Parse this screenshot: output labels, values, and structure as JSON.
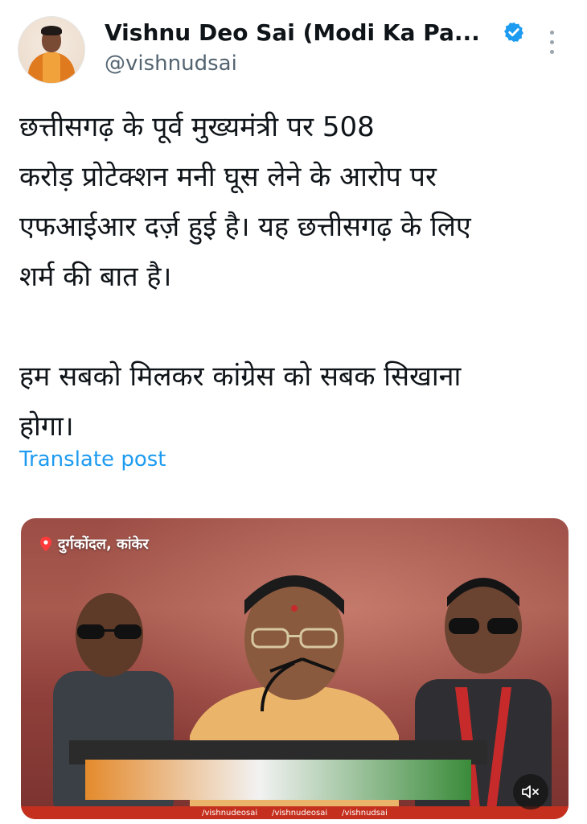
{
  "header": {
    "display_name": "Vishnu Deo Sai (Modi Ka Pa...",
    "handle": "@vishnudsai",
    "verified_icon": "verified-badge-icon",
    "more_icon": "more-options-icon"
  },
  "tweet": {
    "lines_para1": [
      "छत्तीसगढ़ के पूर्व मुख्यमंत्री पर 508",
      "करोड़ प्रोटेक्शन मनी घूस लेने के आरोप पर",
      "एफआईआर दर्ज़ हुई है। यह छत्तीसगढ़ के लिए",
      "शर्म की बात है।"
    ],
    "lines_para2": [
      "हम सबको मिलकर कांग्रेस को सबक सिखाना",
      "होगा।"
    ],
    "translate_label": "Translate post"
  },
  "media": {
    "location": "दुर्गकोंदल, कांकेर",
    "footer_handles": [
      "/vishnudeosai",
      "/vishnudeosai",
      "/vishnudsai"
    ],
    "mute_icon": "volume-muted-icon"
  },
  "colors": {
    "link": "#1d9bf0",
    "verified": "#1d9bf0",
    "handle": "#536471"
  }
}
